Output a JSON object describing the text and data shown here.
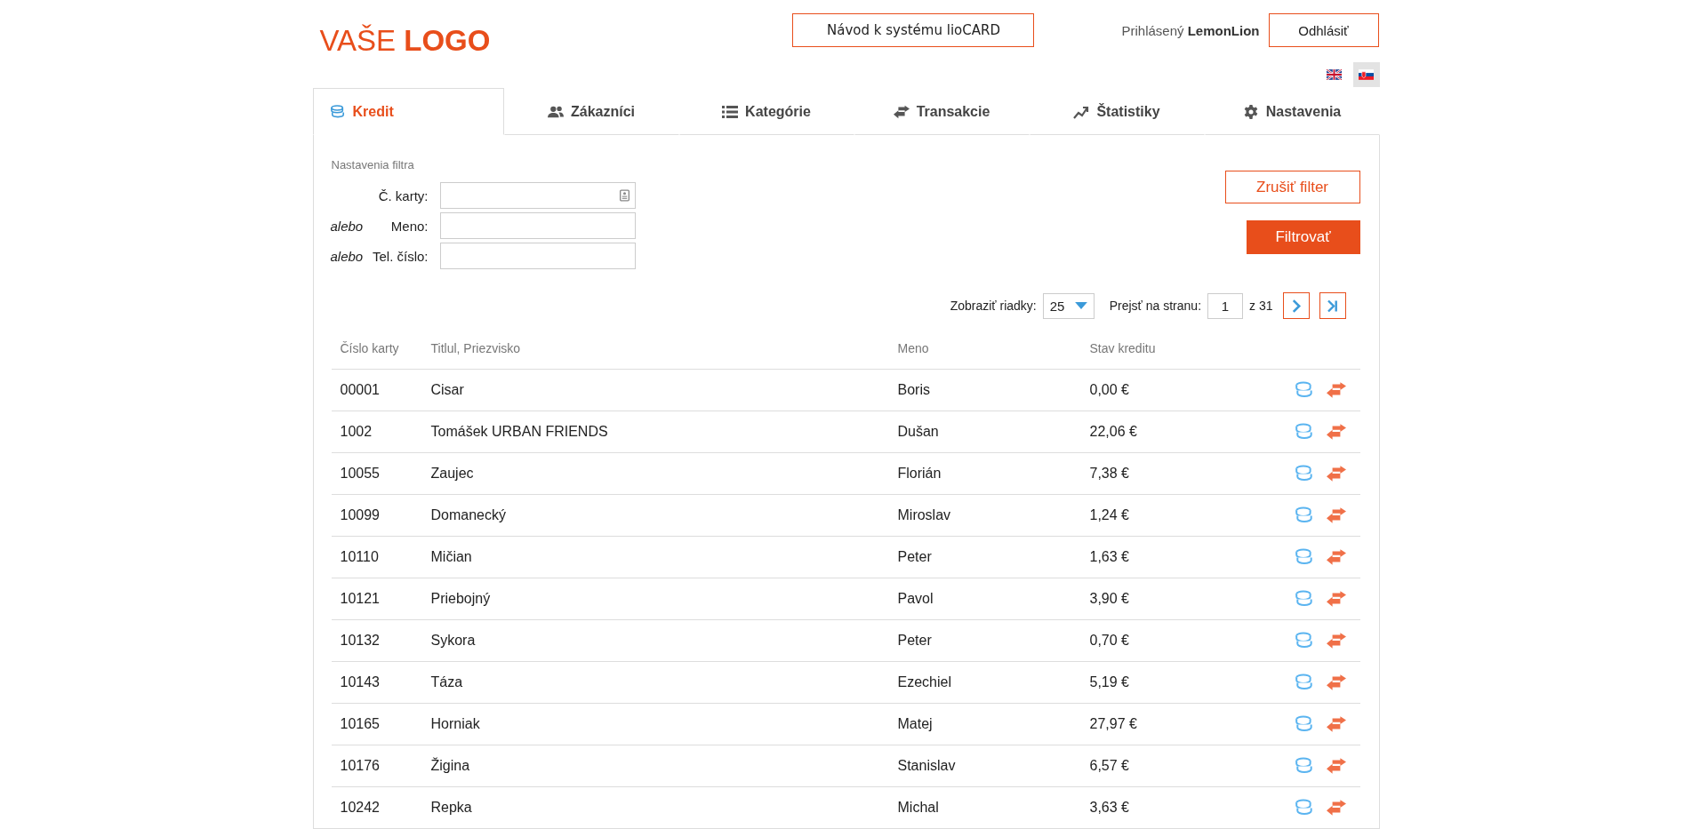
{
  "header": {
    "logo": {
      "part1": "VAŠE",
      "part2": "LOGO"
    },
    "guide_button": "Návod k systému lioCARD",
    "logged_in_label": "Prihlásený",
    "user": "LemonLion",
    "logout_button": "Odhlásiť"
  },
  "languages": [
    {
      "kind": "uk",
      "selected": false
    },
    {
      "kind": "sk",
      "selected": true
    }
  ],
  "tabs": [
    {
      "label": "Kredit",
      "selected": true
    },
    {
      "label": "Zákazníci",
      "selected": false
    },
    {
      "label": "Kategórie",
      "selected": false
    },
    {
      "label": "Transakcie",
      "selected": false
    },
    {
      "label": "Štatistiky",
      "selected": false
    },
    {
      "label": "Nastavenia",
      "selected": false
    }
  ],
  "filter": {
    "title": "Nastavenia filtra",
    "fields": [
      {
        "kind": "card",
        "label": "Č. karty:"
      },
      {
        "kind": "text",
        "prefix": "alebo",
        "label": "Meno:"
      },
      {
        "kind": "text",
        "prefix": "alebo",
        "label": "Tel. číslo:"
      }
    ],
    "clear_button": "Zrušiť filter",
    "filter_button": "Filtrovať"
  },
  "pagination": {
    "rows_label": "Zobraziť riadky:",
    "rows_value": "25",
    "goto_label": "Prejsť na stranu:",
    "page_value": "1",
    "total": "z 31"
  },
  "table": {
    "columns": [
      "Číslo karty",
      "Titlul, Priezvisko",
      "Meno",
      "Stav kreditu"
    ],
    "rows": [
      [
        "00001",
        "Cisar",
        "Boris",
        "0,00 €"
      ],
      [
        "1002",
        "Tomášek URBAN FRIENDS",
        "Dušan",
        "22,06 €"
      ],
      [
        "10055",
        "Zaujec",
        "Florián",
        "7,38 €"
      ],
      [
        "10099",
        "Domanecký",
        "Miroslav",
        "1,24 €"
      ],
      [
        "10110",
        "Mičian",
        "Peter",
        "1,63 €"
      ],
      [
        "10121",
        "Priebojný",
        "Pavol",
        "3,90 €"
      ],
      [
        "10132",
        "Sykora",
        "Peter",
        "0,70 €"
      ],
      [
        "10143",
        "Táza",
        "Ezechiel",
        "5,19 €"
      ],
      [
        "10165",
        "Horniak",
        "Matej",
        "27,97 €"
      ],
      [
        "10176",
        "Žigina",
        "Stanislav",
        "6,57 €"
      ],
      [
        "10242",
        "Repka",
        "Michal",
        "3,63 €"
      ]
    ]
  }
}
